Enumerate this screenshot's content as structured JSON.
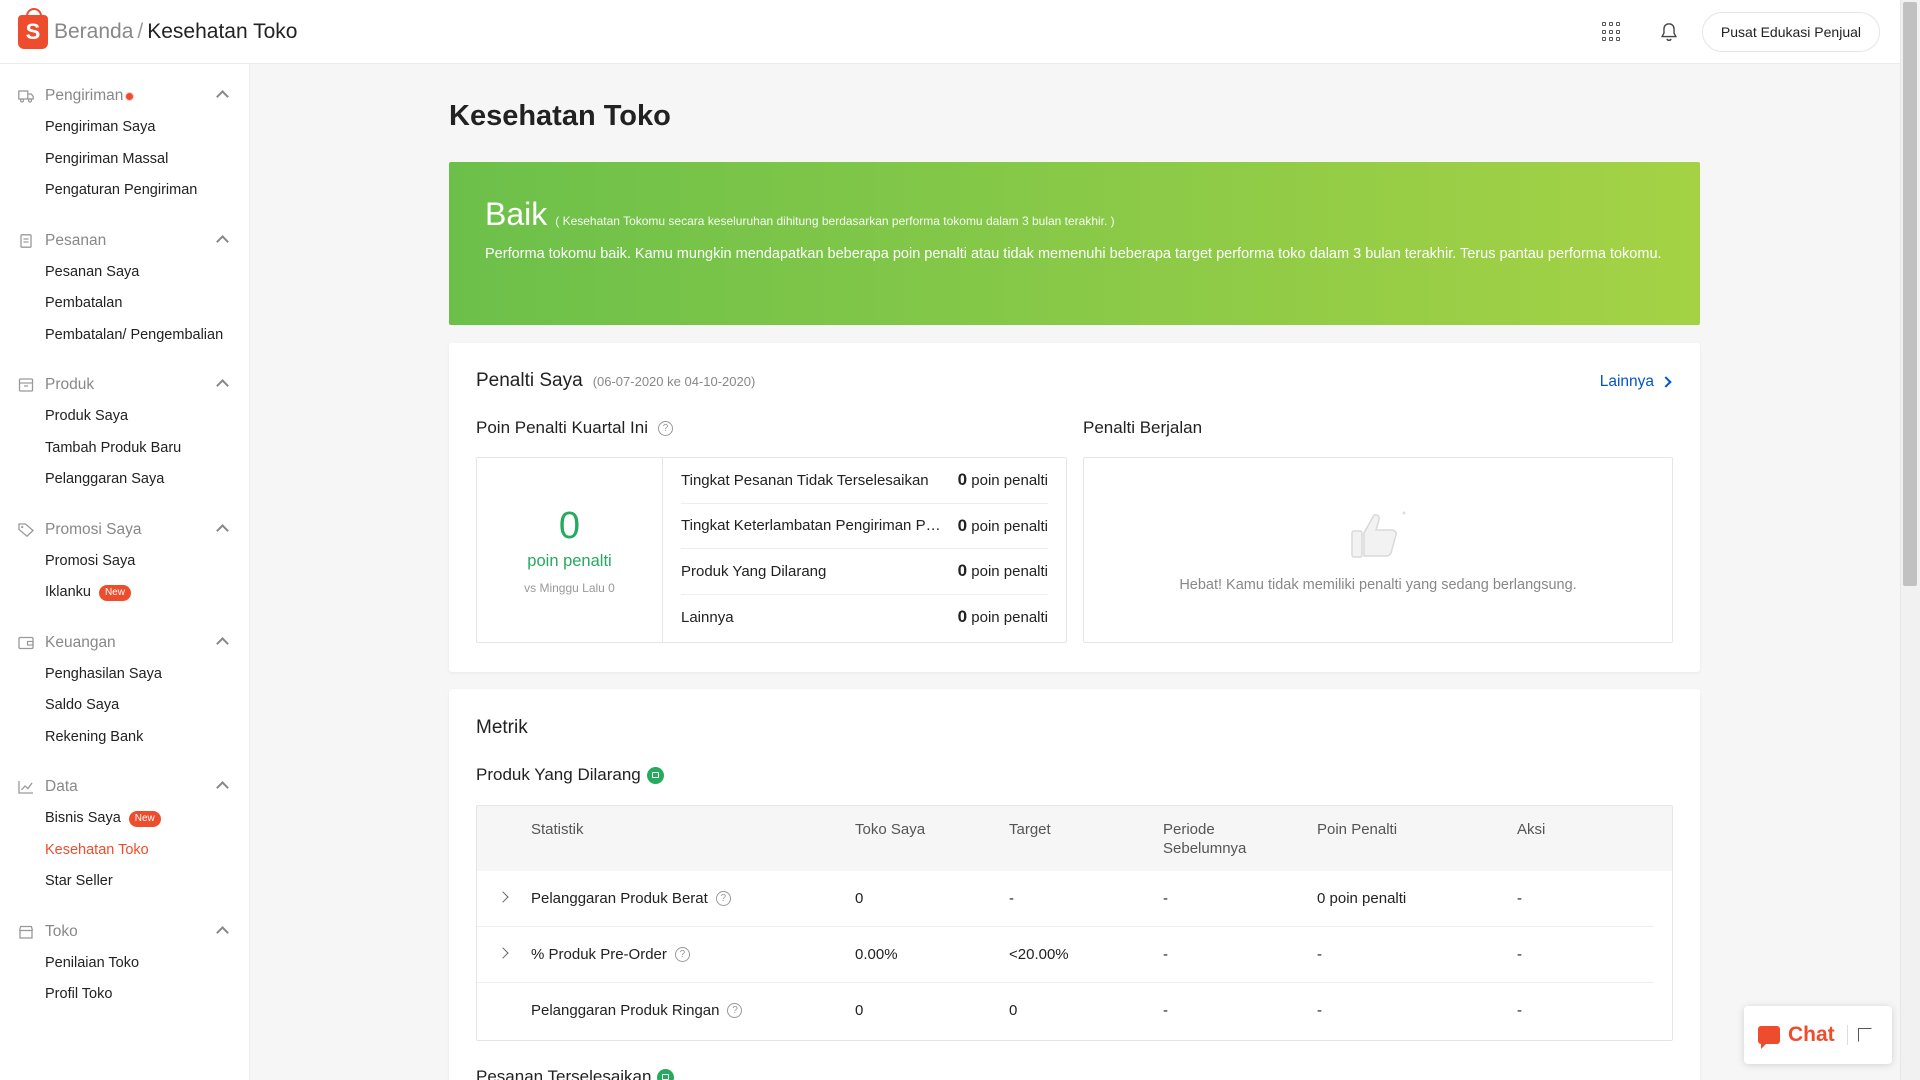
{
  "header": {
    "logo_letter": "S",
    "breadcrumb_home": "Beranda",
    "breadcrumb_sep": "/",
    "breadcrumb_current": "Kesehatan Toko",
    "edu_button": "Pusat Edukasi Penjual"
  },
  "sidebar": {
    "groups": [
      {
        "title": "Pengiriman",
        "has_dot": true,
        "items": [
          "Pengiriman Saya",
          "Pengiriman Massal",
          "Pengaturan Pengiriman"
        ]
      },
      {
        "title": "Pesanan",
        "items": [
          "Pesanan Saya",
          "Pembatalan",
          "Pembatalan/ Pengembalian"
        ]
      },
      {
        "title": "Produk",
        "items": [
          "Produk Saya",
          "Tambah Produk Baru",
          "Pelanggaran Saya"
        ]
      },
      {
        "title": "Promosi Saya",
        "items": [
          "Promosi Saya",
          "Iklanku"
        ]
      },
      {
        "title": "Keuangan",
        "items": [
          "Penghasilan Saya",
          "Saldo Saya",
          "Rekening Bank"
        ]
      },
      {
        "title": "Data",
        "items": [
          "Bisnis Saya",
          "Kesehatan Toko",
          "Star Seller"
        ]
      },
      {
        "title": "Toko",
        "items": [
          "Penilaian Toko",
          "Profil Toko"
        ]
      }
    ],
    "new_badge": "New"
  },
  "main": {
    "page_title": "Kesehatan Toko",
    "status": {
      "label": "Baik",
      "note": "( Kesehatan Tokomu secara keseluruhan dihitung berdasarkan performa tokomu dalam 3 bulan terakhir. )",
      "description": "Performa tokomu baik. Kamu mungkin mendapatkan beberapa poin penalti atau tidak memenuhi beberapa target performa toko dalam 3 bulan terakhir. Terus pantau performa tokomu."
    },
    "penalty": {
      "title": "Penalti Saya",
      "range": "(06-07-2020 ke 04-10-2020)",
      "more_link": "Lainnya",
      "quarter_title": "Poin Penalti Kuartal Ini",
      "total_points": "0",
      "points_unit": "poin penalti",
      "vs_text": "vs Minggu Lalu 0",
      "rows": [
        {
          "label": "Tingkat Pesanan Tidak Terselesaikan",
          "value": "0",
          "unit": "poin penalti"
        },
        {
          "label": "Tingkat Keterlambatan Pengiriman Pesanan",
          "value": "0",
          "unit": "poin penalti"
        },
        {
          "label": "Produk Yang Dilarang",
          "value": "0",
          "unit": "poin penalti"
        },
        {
          "label": "Lainnya",
          "value": "0",
          "unit": "poin penalti"
        }
      ],
      "ongoing_title": "Penalti Berjalan",
      "ongoing_message": "Hebat! Kamu tidak memiliki penalti yang sedang berlangsung."
    },
    "metrics": {
      "title": "Metrik",
      "section_title": "Produk Yang Dilarang",
      "headers": {
        "stat": "Statistik",
        "mine": "Toko Saya",
        "target": "Target",
        "prev": "Periode Sebelumnya",
        "points": "Poin Penalti",
        "action": "Aksi"
      },
      "rows": [
        {
          "stat": "Pelanggaran Produk Berat",
          "mine": "0",
          "target": "-",
          "prev": "-",
          "points": "0 poin penalti",
          "action": "-"
        },
        {
          "stat": "% Produk Pre-Order",
          "mine": "0.00%",
          "target": "<20.00%",
          "prev": "-",
          "points": "-",
          "action": "-"
        },
        {
          "stat": "Pelanggaran Produk Ringan",
          "mine": "0",
          "target": "0",
          "prev": "-",
          "points": "-",
          "action": "-"
        }
      ],
      "next_section_title": "Pesanan Terselesaikan"
    }
  },
  "chat": {
    "label": "Chat"
  },
  "colors": {
    "brand": "#ee4d2d",
    "good": "#26aa5f",
    "link": "#0055cc"
  }
}
